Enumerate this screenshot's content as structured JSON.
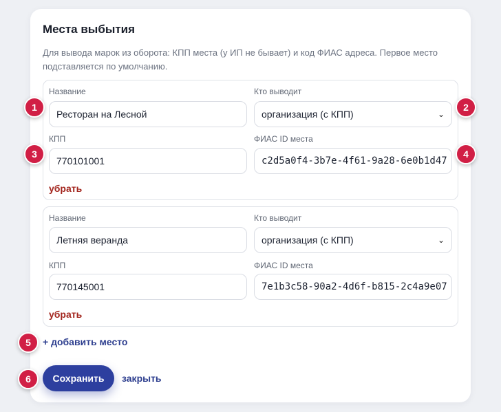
{
  "title": "Места выбытия",
  "description": "Для вывода марок из оборота: КПП места (у ИП не бывает) и код ФИАС адреса. Первое место подставляется по умолчанию.",
  "labels": {
    "name": "Название",
    "who": "Кто выводит",
    "kpp": "КПП",
    "fias": "ФИАС ID места"
  },
  "places": [
    {
      "name": "Ресторан на Лесной",
      "who": "организация (с КПП)",
      "kpp": "770101001",
      "fias": "c2d5a0f4-3b7e-4f61-9a28-6e0b1d47",
      "remove_label": "убрать"
    },
    {
      "name": "Летняя веранда",
      "who": "организация (с КПП)",
      "kpp": "770145001",
      "fias": "7e1b3c58-90a2-4d6f-b815-2c4a9e07",
      "remove_label": "убрать"
    }
  ],
  "add_label": "+ добавить место",
  "save_label": "Сохранить",
  "close_label": "закрыть",
  "badges": [
    "1",
    "2",
    "3",
    "4",
    "5",
    "6"
  ],
  "colors": {
    "accent": "#2d3f9f",
    "danger": "#a3261e",
    "badge": "#d11f45"
  }
}
